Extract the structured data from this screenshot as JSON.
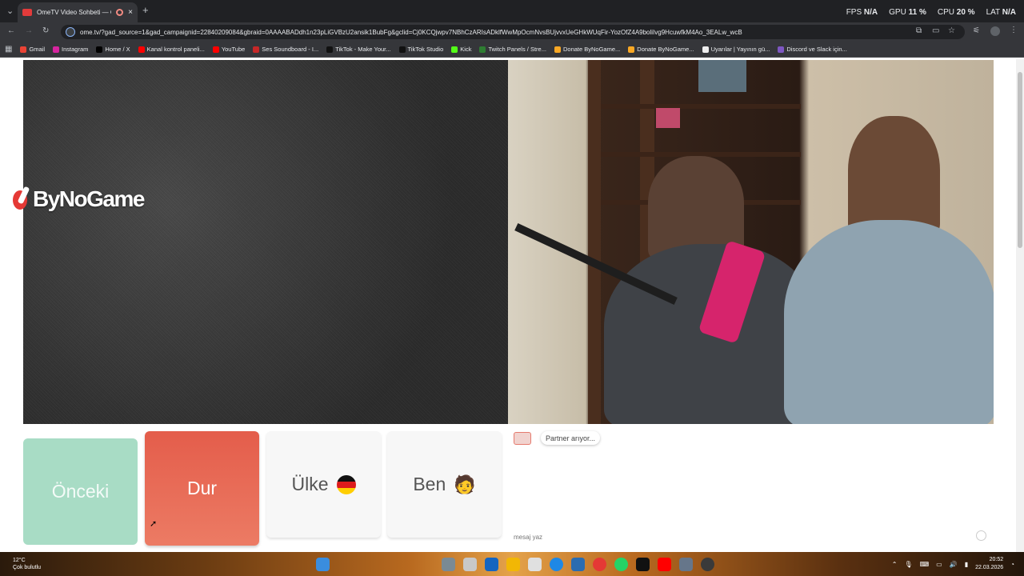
{
  "browser": {
    "tab_title": "OmeTV Video Sohbeti — O",
    "url": "ome.tv/?gad_source=1&gad_campaignid=22840209084&gbraid=0AAAABADdh1n23pLiGVBzU2ansik1BubFg&gclid=Cj0KCQjwpv7NBhCzARIsADklfWwMpOcmNvsBUjvvxUeGHkWUqFir-YozOfZ4A9boliIvg9HcuwfkM4Ao_3EALw_wcB",
    "new_tab": "+",
    "close": "×",
    "perf": {
      "fps_label": "FPS",
      "fps_value": "N/A",
      "gpu_label": "GPU",
      "gpu_value": "11 %",
      "cpu_label": "CPU",
      "cpu_value": "20 %",
      "lat_label": "LAT",
      "lat_value": "N/A"
    },
    "bookmarks": [
      {
        "label": "Gmail",
        "color": "#ea4335"
      },
      {
        "label": "Instagram",
        "color": "#d6249f"
      },
      {
        "label": "Home / X",
        "color": "#000000"
      },
      {
        "label": "Kanal kontrol paneli...",
        "color": "#ff0000"
      },
      {
        "label": "YouTube",
        "color": "#ff0000"
      },
      {
        "label": "Ses Soundboard - I...",
        "color": "#c62828"
      },
      {
        "label": "TikTok - Make Your...",
        "color": "#111111"
      },
      {
        "label": "TikTok Studio",
        "color": "#111111"
      },
      {
        "label": "Kick",
        "color": "#53fc18"
      },
      {
        "label": "Twitch Panels / Stre...",
        "color": "#2e7d32"
      },
      {
        "label": "Donate ByNoGame...",
        "color": "#f9a825"
      },
      {
        "label": "Donate ByNoGame...",
        "color": "#f9a825"
      },
      {
        "label": "Uyarılar | Yayının gü...",
        "color": "#eeeeee"
      },
      {
        "label": "Discord ve Slack için...",
        "color": "#7e57c2"
      }
    ]
  },
  "video": {
    "logo_text": "ByNoGame"
  },
  "controls": {
    "prev_label": "Önceki",
    "stop_label": "Dur",
    "country_label": "Ülke",
    "me_label": "Ben",
    "me_emoji": "🧑"
  },
  "chat": {
    "status": "Partner arıyor...",
    "input_placeholder": "mesaj yaz"
  },
  "taskbar": {
    "temp": "12°C",
    "weather": "Çok bulutlu",
    "time": "20:52",
    "date": "22.03.2026"
  }
}
